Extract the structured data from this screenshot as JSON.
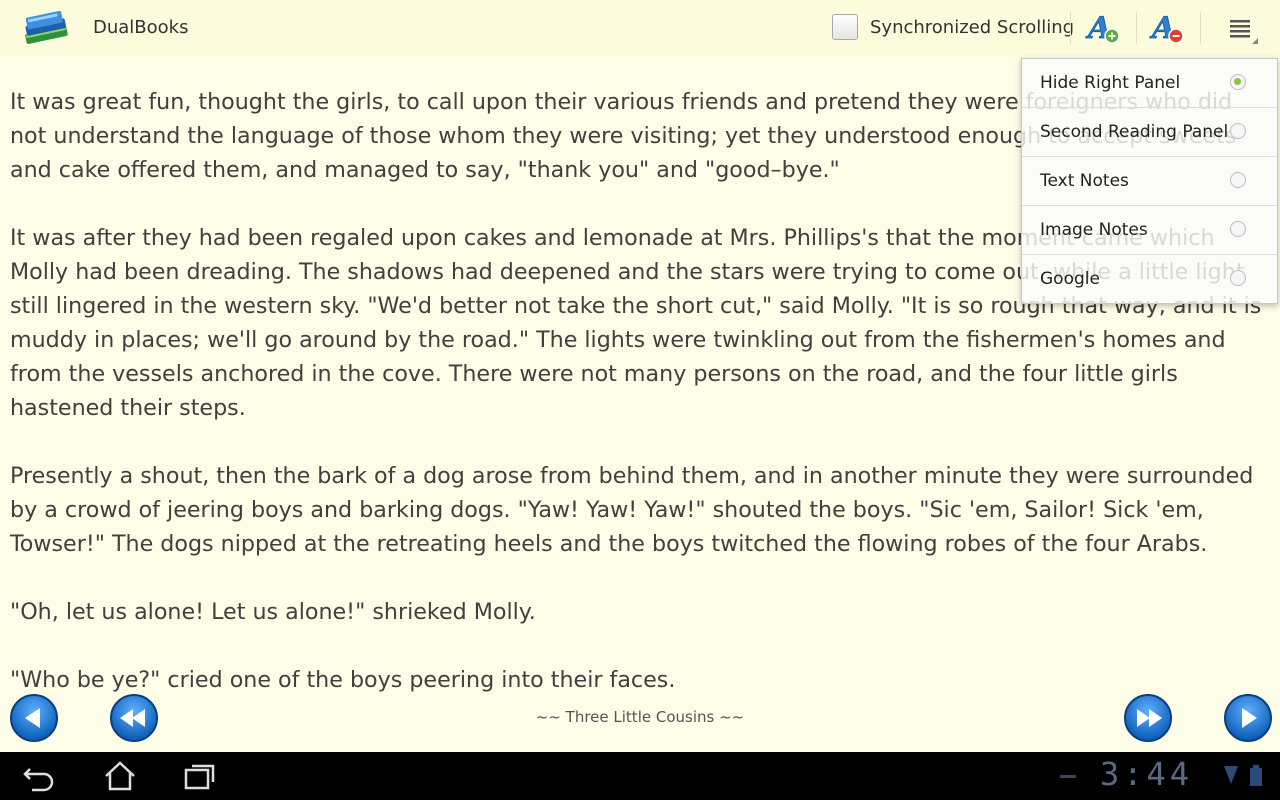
{
  "app": {
    "title": "DualBooks"
  },
  "toolbar": {
    "sync_label": "Synchronized Scrolling",
    "sync_checked": false
  },
  "content": {
    "paragraphs": [
      "It was great fun, thought the girls, to call upon their various friends and pretend they were foreigners who did not understand the language of those whom they were visiting; yet they understood enough to accept sweets and cake offered them, and managed to say, \"thank you\" and \"good–bye.\"",
      "It was after they had been regaled upon cakes and lemonade at Mrs. Phillips's that the moment came which Molly had been dreading. The shadows had deepened and the stars were trying to come out, while a little light still lingered in the western sky. \"We'd better not take the short cut,\" said Molly. \"It is so rough that way, and it is muddy in places; we'll go around by the road.\" The lights were twinkling out from the fishermen's homes and from the vessels anchored in the cove. There were not many persons on the road, and the four little girls hastened their steps.",
      "Presently a shout, then the bark of a dog arose from behind them, and in another minute they were surrounded by a crowd of jeering boys and barking dogs. \"Yaw! Yaw! Yaw!\" shouted the boys. \"Sic 'em, Sailor! Sick 'em, Towser!\" The dogs nipped at the retreating heels and the boys twitched the flowing robes of the four Arabs.",
      "\"Oh, let us alone! Let us alone!\" shrieked Molly.",
      "\"Who be ye?\" cried one of the boys peering into their faces."
    ]
  },
  "footer": {
    "book_title": "~~ Three Little Cousins ~~"
  },
  "menu": {
    "items": [
      {
        "label": "Hide Right Panel",
        "selected": true
      },
      {
        "label": "Second Reading Panel",
        "selected": false
      },
      {
        "label": "Text Notes",
        "selected": false
      },
      {
        "label": "Image Notes",
        "selected": false
      },
      {
        "label": "Google",
        "selected": false
      }
    ]
  },
  "system": {
    "clock": "3:44"
  },
  "icons": {
    "app": "book-stack-icon",
    "font_increase": "font-increase-icon",
    "font_decrease": "font-decrease-icon",
    "overflow": "overflow-menu-icon",
    "prev": "previous-page-icon",
    "rewind": "rewind-icon",
    "fastforward": "fast-forward-icon",
    "next": "next-page-icon",
    "back": "back-icon",
    "home": "home-icon",
    "recent": "recent-apps-icon"
  },
  "colors": {
    "background": "#fefde8",
    "text": "#404040",
    "nav_blue": "#1f6fc4",
    "radio_active": "#8bc34a"
  }
}
